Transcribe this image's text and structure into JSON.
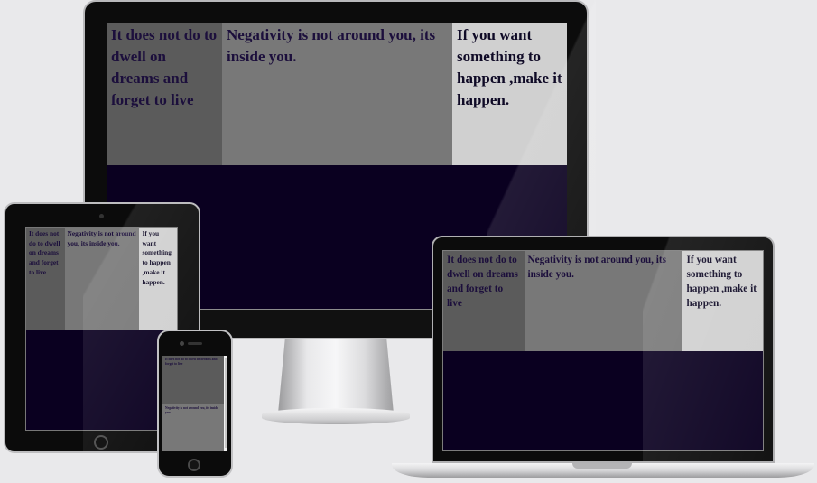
{
  "quotes": {
    "col1": "It does not do to dwell on dreams and forget to live",
    "col2": "Negativity is not around you, its inside you.",
    "col3": "If you want something to happen ,make it happen."
  },
  "colors": {
    "background": "#e9e9eb",
    "col1_bg": "#5b5b5b",
    "col2_bg": "#787878",
    "col3_bg": "#d0d0d0",
    "bottom_section_bg": "#0a0020",
    "text": "#1c0f3c"
  },
  "devices": [
    "desktop-monitor",
    "laptop",
    "tablet",
    "phone"
  ]
}
